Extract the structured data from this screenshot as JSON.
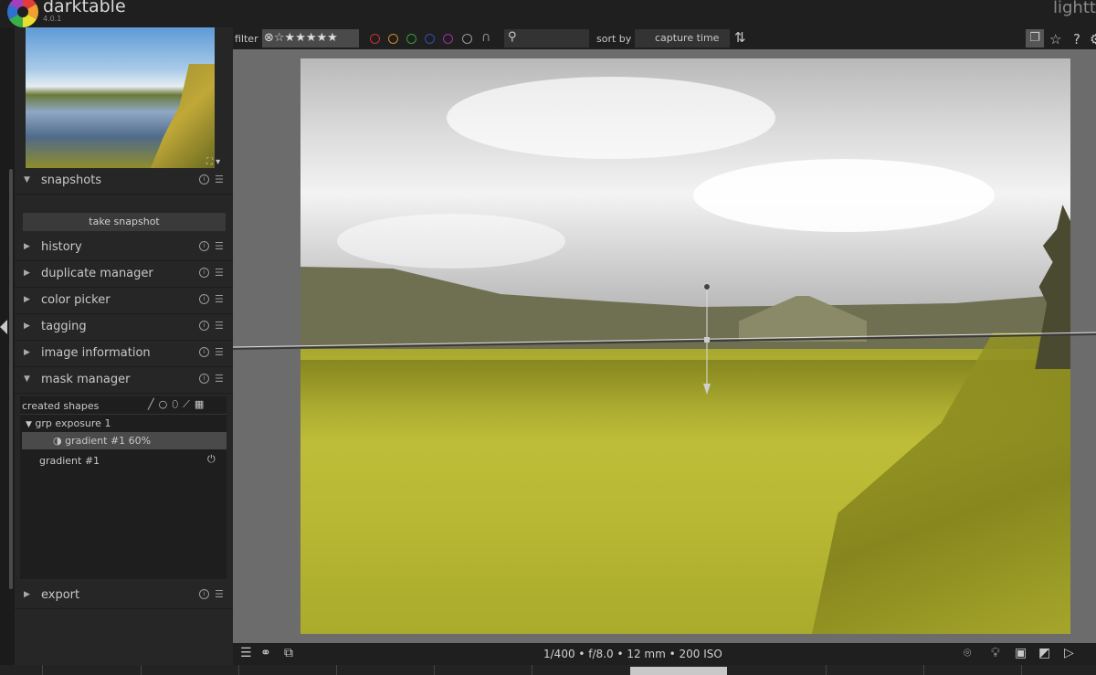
{
  "app": {
    "name": "darktable",
    "version": "4.0.1",
    "view": "lighttable"
  },
  "left_panel": {
    "modules": [
      {
        "label": "snapshots",
        "expanded": true
      },
      {
        "label": "history",
        "expanded": false
      },
      {
        "label": "duplicate manager",
        "expanded": false
      },
      {
        "label": "color picker",
        "expanded": false
      },
      {
        "label": "tagging",
        "expanded": false
      },
      {
        "label": "image information",
        "expanded": false
      },
      {
        "label": "mask manager",
        "expanded": true
      },
      {
        "label": "export",
        "expanded": false
      }
    ],
    "snapshot_button": "take snapshot",
    "mask_manager": {
      "header": "created shapes",
      "group": "grp exposure 1",
      "selected_shape": "gradient #1 60%",
      "shape": "gradient #1"
    }
  },
  "filterbar": {
    "filter_label": "filter",
    "stars": "⊗☆★★★★★",
    "sort_label": "sort by",
    "sort_value": "capture time",
    "sort_chevron": "⌄",
    "color_labels": [
      "#c83232",
      "#d08a28",
      "#3a9a3a",
      "#3050b0",
      "#a030a0",
      "#9a9a9a"
    ]
  },
  "bottombar": {
    "exif": "1/400 • f/8.0 • 12 mm • 200 ISO"
  },
  "icons": {
    "expanded_arrow": "▼",
    "collapsed_arrow": "▶",
    "reset": "i",
    "presets": "☰"
  }
}
